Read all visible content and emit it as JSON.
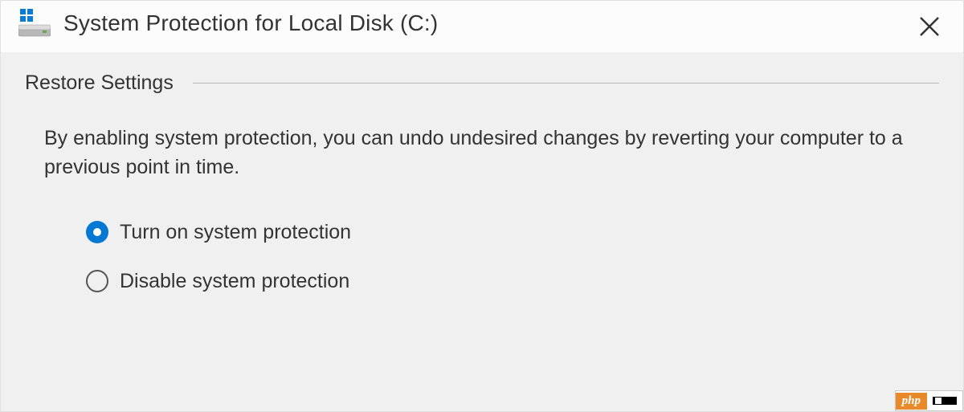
{
  "titlebar": {
    "title": "System Protection for Local Disk (C:)"
  },
  "section": {
    "heading": "Restore Settings",
    "description": "By enabling system protection, you can undo undesired changes by reverting your computer to a previous point in time."
  },
  "options": {
    "turn_on": "Turn on system protection",
    "disable": "Disable system protection",
    "selected": "turn_on"
  },
  "watermark": {
    "left": "php"
  }
}
